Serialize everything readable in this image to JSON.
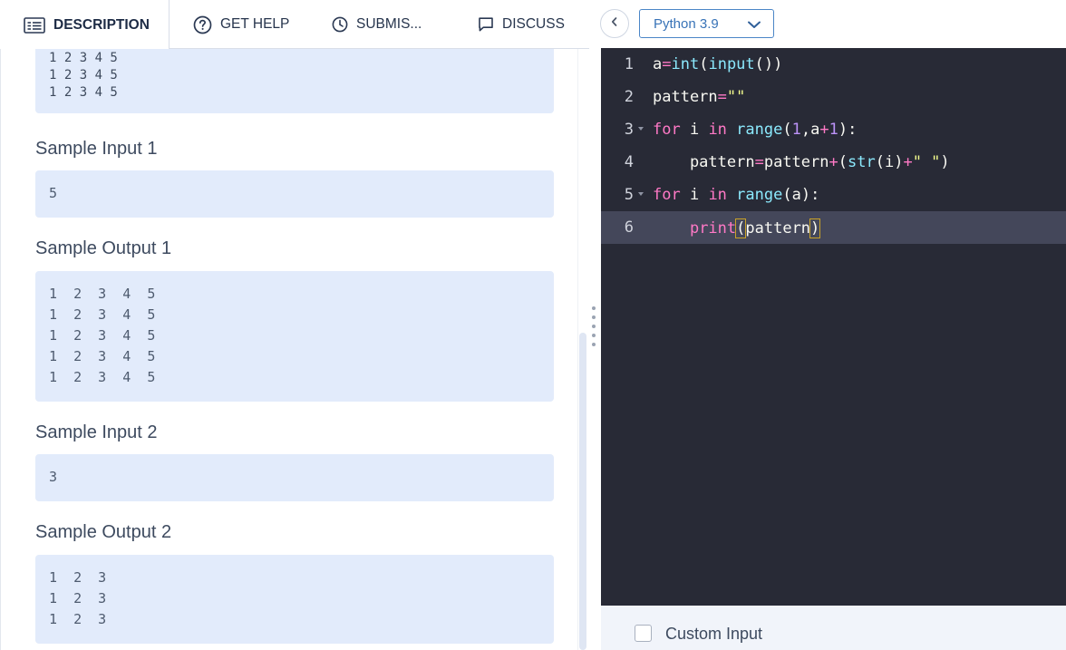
{
  "tabs": {
    "description": "DESCRIPTION",
    "get_help": "GET HELP",
    "submissions": "SUBMIS...",
    "discuss": "DISCUSS"
  },
  "description": {
    "top_output": "1 2 3 4 5\n1 2 3 4 5\n1 2 3 4 5",
    "sample_input_1_title": "Sample Input 1",
    "sample_input_1": "5",
    "sample_output_1_title": "Sample Output 1",
    "sample_output_1": "1  2  3  4  5\n1  2  3  4  5\n1  2  3  4  5\n1  2  3  4  5\n1  2  3  4  5",
    "sample_input_2_title": "Sample Input 2",
    "sample_input_2": "3",
    "sample_output_2_title": "Sample Output 2",
    "sample_output_2": "1  2  3\n1  2  3\n1  2  3"
  },
  "editor": {
    "language": "Python 3.9",
    "lines": [
      {
        "num": "1",
        "code": "a=int(input())"
      },
      {
        "num": "2",
        "code": "pattern=\"\""
      },
      {
        "num": "3",
        "code": "for i in range(1,a+1):"
      },
      {
        "num": "4",
        "code": "    pattern=pattern+(str(i)+\" \")"
      },
      {
        "num": "5",
        "code": "for i in range(a):"
      },
      {
        "num": "6",
        "code": "    print(pattern)"
      }
    ],
    "active_line": "6"
  },
  "footer": {
    "custom_input_label": "Custom Input",
    "custom_input_checked": false
  },
  "icons": {
    "description_tab": "document-list-icon",
    "get_help_tab": "question-circle-icon",
    "submissions_tab": "clock-icon",
    "discuss_tab": "chat-bubble-icon",
    "collapse": "chevron-left-icon",
    "language_dropdown": "chevron-down-icon"
  },
  "colors": {
    "editor_bg": "#282a36",
    "active_line_bg": "#44475a",
    "sample_box_bg": "#e2ebfb",
    "accent_blue": "#3873b7"
  }
}
